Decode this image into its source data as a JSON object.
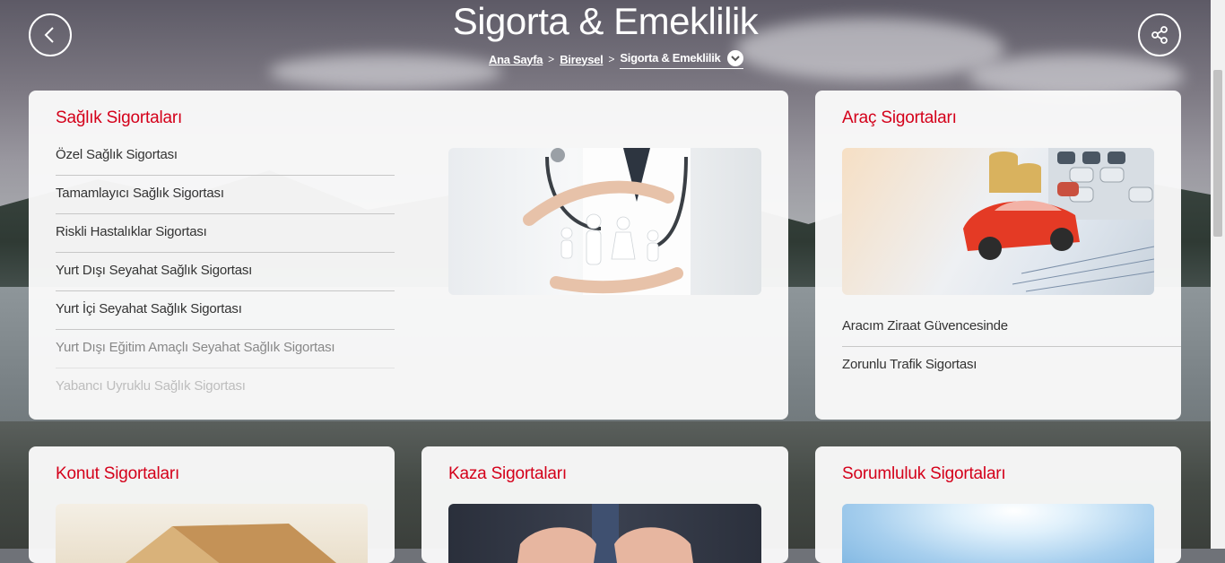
{
  "header": {
    "title": "Sigorta & Emeklilik",
    "breadcrumb": [
      "Ana Sayfa",
      "Bireysel"
    ],
    "breadcrumb_current": "Sigorta & Emeklilik"
  },
  "icons": {
    "back": "chevron-left-icon",
    "share": "share-icon",
    "dropdown": "chevron-down-icon"
  },
  "colors": {
    "accent": "#d4001a",
    "text": "#333333"
  },
  "cards": {
    "health": {
      "title": "Sağlık Sigortaları",
      "items": [
        "Özel Sağlık Sigortası",
        "Tamamlayıcı Sağlık Sigortası",
        "Riskli Hastalıklar Sigortası",
        "Yurt Dışı Seyahat Sağlık Sigortası",
        "Yurt İçi Seyahat Sağlık Sigortası",
        "Yurt Dışı Eğitim Amaçlı Seyahat Sağlık Sigortası",
        "Yabancı Uyruklu Sağlık Sigortası"
      ]
    },
    "vehicle": {
      "title": "Araç Sigortaları",
      "items": [
        "Aracım Ziraat Güvencesinde",
        "Zorunlu Trafik Sigortası"
      ]
    },
    "home": {
      "title": "Konut Sigortaları"
    },
    "accident": {
      "title": "Kaza Sigortaları"
    },
    "liability": {
      "title": "Sorumluluk Sigortaları"
    }
  }
}
